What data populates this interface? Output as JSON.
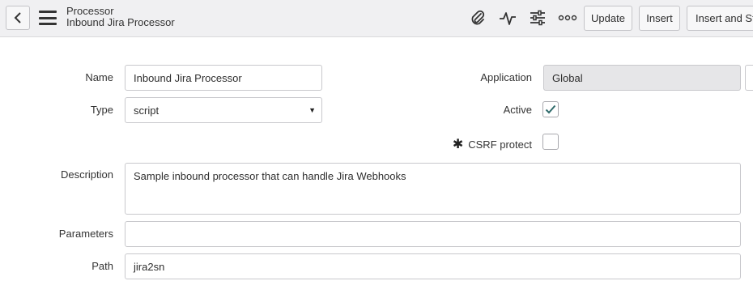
{
  "header": {
    "record_type": "Processor",
    "record_name": "Inbound Jira Processor",
    "buttons": {
      "update": "Update",
      "insert": "Insert",
      "insert_and_stay": "Insert and Stay"
    },
    "icons": [
      "chevron-left-icon",
      "hamburger-menu-icon",
      "paperclip-icon",
      "activity-pulse-icon",
      "settings-sliders-icon",
      "more-options-icon"
    ]
  },
  "form": {
    "name": {
      "label": "Name",
      "value": "Inbound Jira Processor"
    },
    "type": {
      "label": "Type",
      "value": "script"
    },
    "application": {
      "label": "Application",
      "value": "Global"
    },
    "active": {
      "label": "Active",
      "checked": true
    },
    "csrf_protect": {
      "label": "CSRF protect",
      "checked": false,
      "mandatory_marker": "✱"
    },
    "description": {
      "label": "Description",
      "value": "Sample inbound processor that can handle Jira Webhooks"
    },
    "parameters": {
      "label": "Parameters",
      "value": ""
    },
    "path": {
      "label": "Path",
      "value": "jira2sn"
    }
  },
  "colors": {
    "accent_check": "#2f6b6b",
    "header_bg": "#f0f0f2"
  }
}
